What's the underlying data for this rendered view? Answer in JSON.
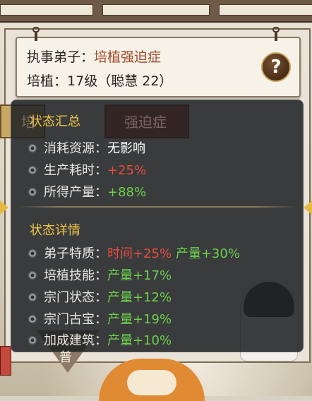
{
  "header": {
    "line1_label": "执事弟子：",
    "line1_value": "培植强迫症",
    "line2_label": "培植：",
    "line2_value": "17级（聪慧 22）",
    "help_label": "?"
  },
  "background": {
    "tab_label": "强迫症",
    "left_tab_label": "培",
    "bottom_label": "普"
  },
  "summary": {
    "title": "状态汇总",
    "rows": [
      {
        "label": "消耗资源：",
        "value": "无影响"
      },
      {
        "label": "生产耗时：",
        "value": "+25%"
      },
      {
        "label": "所得产量：",
        "value": "+88%"
      }
    ]
  },
  "details": {
    "title": "状态详情",
    "rows": [
      {
        "label": "弟子特质：",
        "value_a": "时间+25%",
        "value_b": "产量+30%"
      },
      {
        "label": "培植技能：",
        "value_a": "产量+17%"
      },
      {
        "label": "宗门状态：",
        "value_a": "产量+12%"
      },
      {
        "label": "宗门古宝：",
        "value_a": "产量+19%"
      },
      {
        "label": "加成建筑：",
        "value_a": "产量+10%"
      }
    ]
  },
  "colors": {
    "title_gold": "#f1c64a",
    "positive_green": "#6fd14d",
    "negative_red": "#ea4b3f",
    "header_highlight": "#a5492a"
  }
}
